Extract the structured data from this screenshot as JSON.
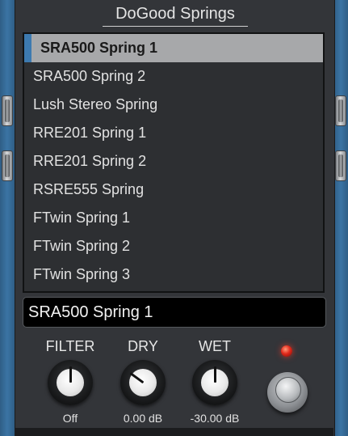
{
  "title": "DoGood Springs",
  "presets": [
    {
      "label": "SRA500 Spring 1",
      "selected": true
    },
    {
      "label": "SRA500 Spring 2",
      "selected": false
    },
    {
      "label": "Lush Stereo Spring",
      "selected": false
    },
    {
      "label": "RRE201 Spring 1",
      "selected": false
    },
    {
      "label": "RRE201 Spring 2",
      "selected": false
    },
    {
      "label": "RSRE555 Spring",
      "selected": false
    },
    {
      "label": "FTwin Spring 1",
      "selected": false
    },
    {
      "label": "FTwin Spring 2",
      "selected": false
    },
    {
      "label": "FTwin Spring 3",
      "selected": false
    }
  ],
  "current_preset": "SRA500 Spring 1",
  "knobs": {
    "filter": {
      "label": "FILTER",
      "value": "Off",
      "level": 0.5
    },
    "dry": {
      "label": "DRY",
      "value": "0.00 dB",
      "level": 0.3
    },
    "wet": {
      "label": "WET",
      "value": "-30.00 dB",
      "level": 0.5
    }
  },
  "led": {
    "state": "on",
    "color": "#e2291b"
  },
  "colors": {
    "enclosure_blue": "#3b74a4",
    "panel": "#333539",
    "selection": "#a7a8aa"
  }
}
